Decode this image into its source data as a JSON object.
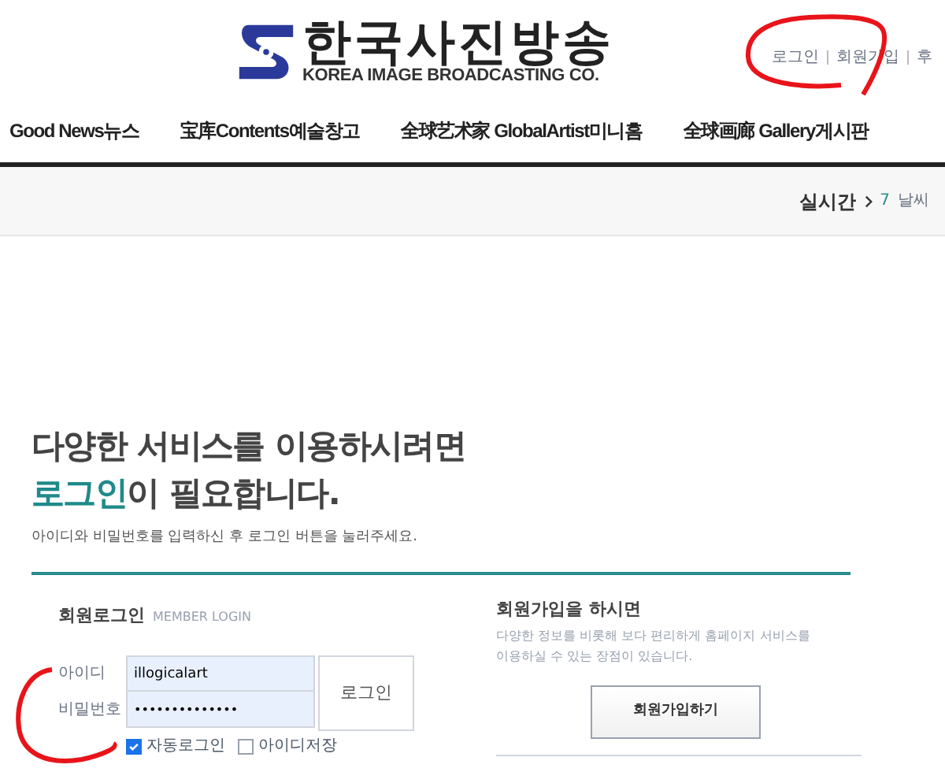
{
  "header": {
    "logo_korean": "한국사진방송",
    "logo_english": "KOREA IMAGE BROADCASTING CO.",
    "top_links": [
      "로그인",
      "회원가입",
      "후"
    ]
  },
  "nav": {
    "items": [
      "Good News뉴스",
      "宝库Contents예술창고",
      "全球艺术家 GlobalArtist미니홈",
      "全球画廊 Gallery게시판"
    ]
  },
  "ticker": {
    "label": "실시간",
    "count": "7",
    "text": "날씨"
  },
  "intro": {
    "heading_line1": "다양한 서비스를 이용하시려면",
    "heading_line2_highlight": "로그인",
    "heading_line2_rest": "이 필요합니다.",
    "description": "아이디와 비밀번호를 입력하신 후 로그인 버튼을 눌러주세요."
  },
  "login": {
    "title": "회원로그인",
    "subtitle": "MEMBER LOGIN",
    "id_label": "아이디",
    "id_value": "illogicalart",
    "password_label": "비밀번호",
    "password_value": "••••••••••••••",
    "button": "로그인",
    "options": [
      {
        "label": "자동로그인",
        "checked": true
      },
      {
        "label": "아이디저장",
        "checked": false
      }
    ]
  },
  "signup": {
    "title": "회원가입을 하시면",
    "description": "다양한 정보를 비롯해 보다 편리하게 홈페이지 서비스를 이용하실 수 있는 장점이 있습니다.",
    "button": "회원가입하기"
  }
}
